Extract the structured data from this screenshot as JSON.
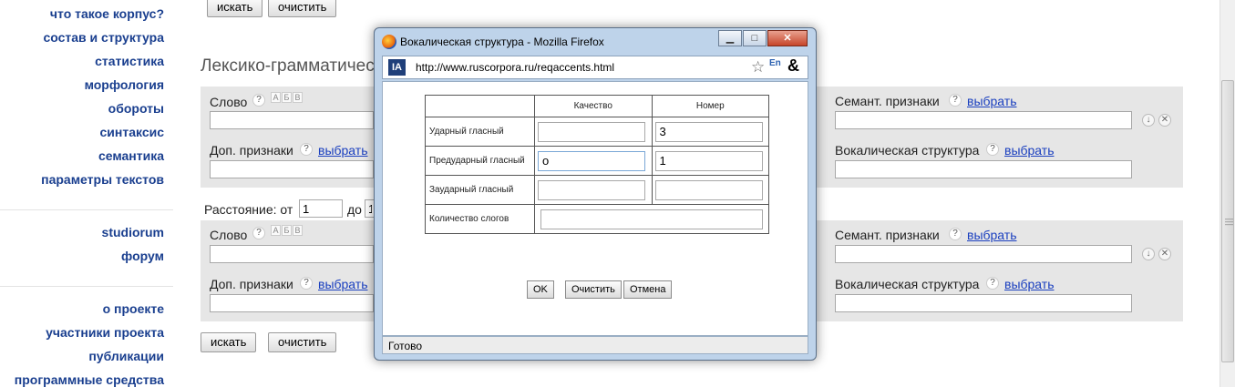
{
  "nav": {
    "items": [
      "что такое корпус?",
      "состав и структура",
      "статистика",
      "морфология",
      "обороты",
      "синтаксис",
      "семантика",
      "параметры текстов"
    ],
    "items2": [
      "studiorum",
      "форум"
    ],
    "items3": [
      "о проекте",
      "участники проекта",
      "публикации",
      "программные средства"
    ]
  },
  "buttons": {
    "search": "искать",
    "clear": "очистить"
  },
  "heading": "Лексико-грамматичес",
  "form": {
    "word_label": "Слово",
    "help": "?",
    "abv": [
      "А",
      "Б",
      "В"
    ],
    "extra_label": "Доп. признаки",
    "choose": "выбрать",
    "semant_label": "Семант. признаки",
    "vocal_label": "Вокалическая структура",
    "distance_label": "Расстояние: от",
    "distance_from": "1",
    "distance_to_label": "до",
    "distance_to": "1"
  },
  "popup": {
    "title": "Вокалическая структура - Mozilla Firefox",
    "url": "http://www.ruscorpora.ru/reqaccents.html",
    "lang_badge": "En",
    "status": "Готово",
    "table": {
      "col_quality": "Качество",
      "col_number": "Номер",
      "rows": [
        {
          "label": "Ударный гласный",
          "quality": "",
          "number": "3"
        },
        {
          "label": "Предударный гласный",
          "quality": "о",
          "number": "1"
        },
        {
          "label": "Заударный гласный",
          "quality": "",
          "number": ""
        }
      ],
      "syllables_label": "Количество слогов",
      "syllables_value": ""
    },
    "ok": "OK",
    "clear": "Очистить",
    "cancel": "Отмена"
  },
  "colors": {
    "nav_link": "#1a3f8f",
    "link": "#1a3fbf",
    "panel_bg": "#e6e6e6"
  }
}
